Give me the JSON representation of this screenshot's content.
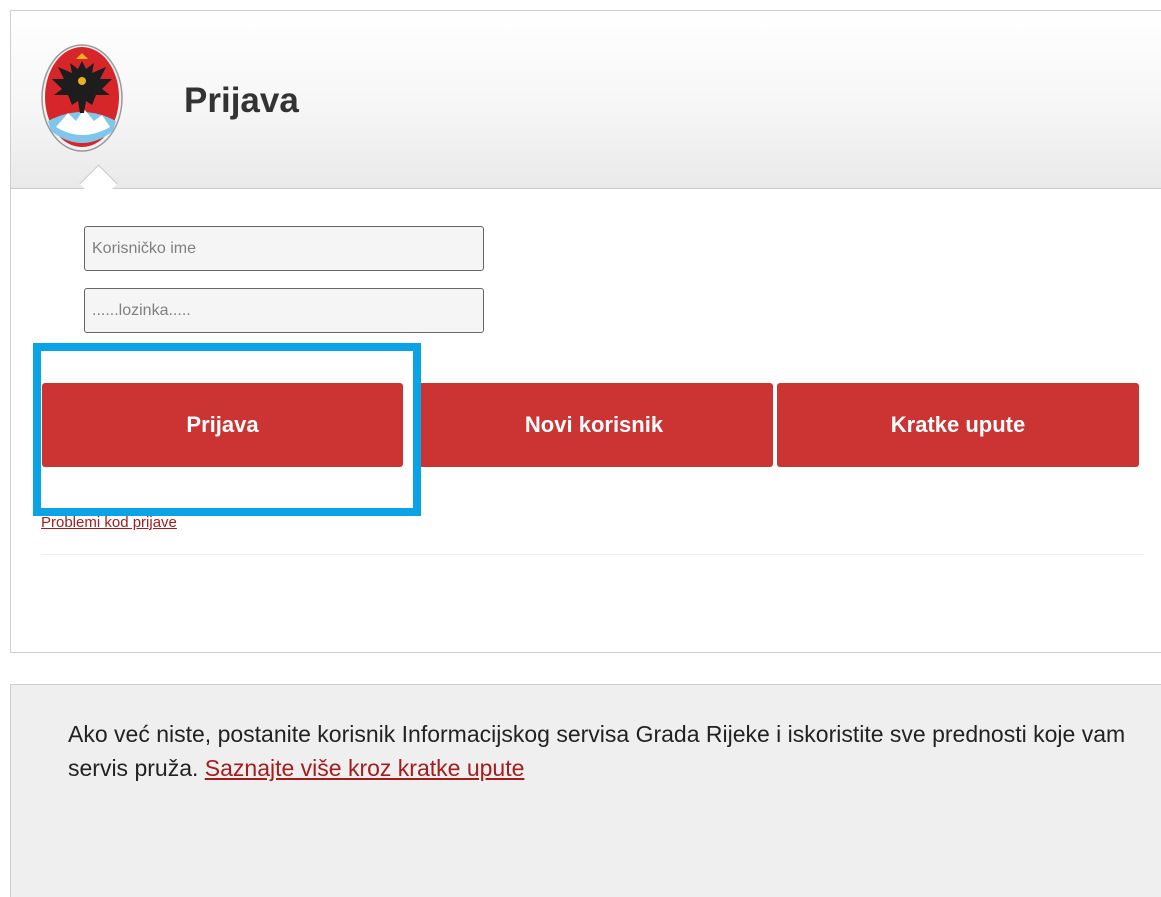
{
  "header": {
    "title": "Prijava",
    "crest_icon": "city-of-rijeka-coat-of-arms-icon"
  },
  "form": {
    "username_placeholder": "Korisničko ime",
    "password_placeholder": "......lozinka.....",
    "username_value": "",
    "password_value": ""
  },
  "buttons": {
    "login_label": "Prijava",
    "register_label": "Novi korisnik",
    "guide_label": "Kratke upute"
  },
  "links": {
    "login_problems": "Problemi kod prijave"
  },
  "info": {
    "text": "Ako već niste, postanite korisnik Informacijskog servisa Grada Rijeke i iskoristite sve prednosti koje vam servis pruža.",
    "link_text": "Saznajte više kroz kratke upute"
  },
  "colors": {
    "button_bg": "#cc3433",
    "link": "#a31d1d",
    "highlight": "#0aa3e6",
    "panel_bg": "#efefef"
  }
}
